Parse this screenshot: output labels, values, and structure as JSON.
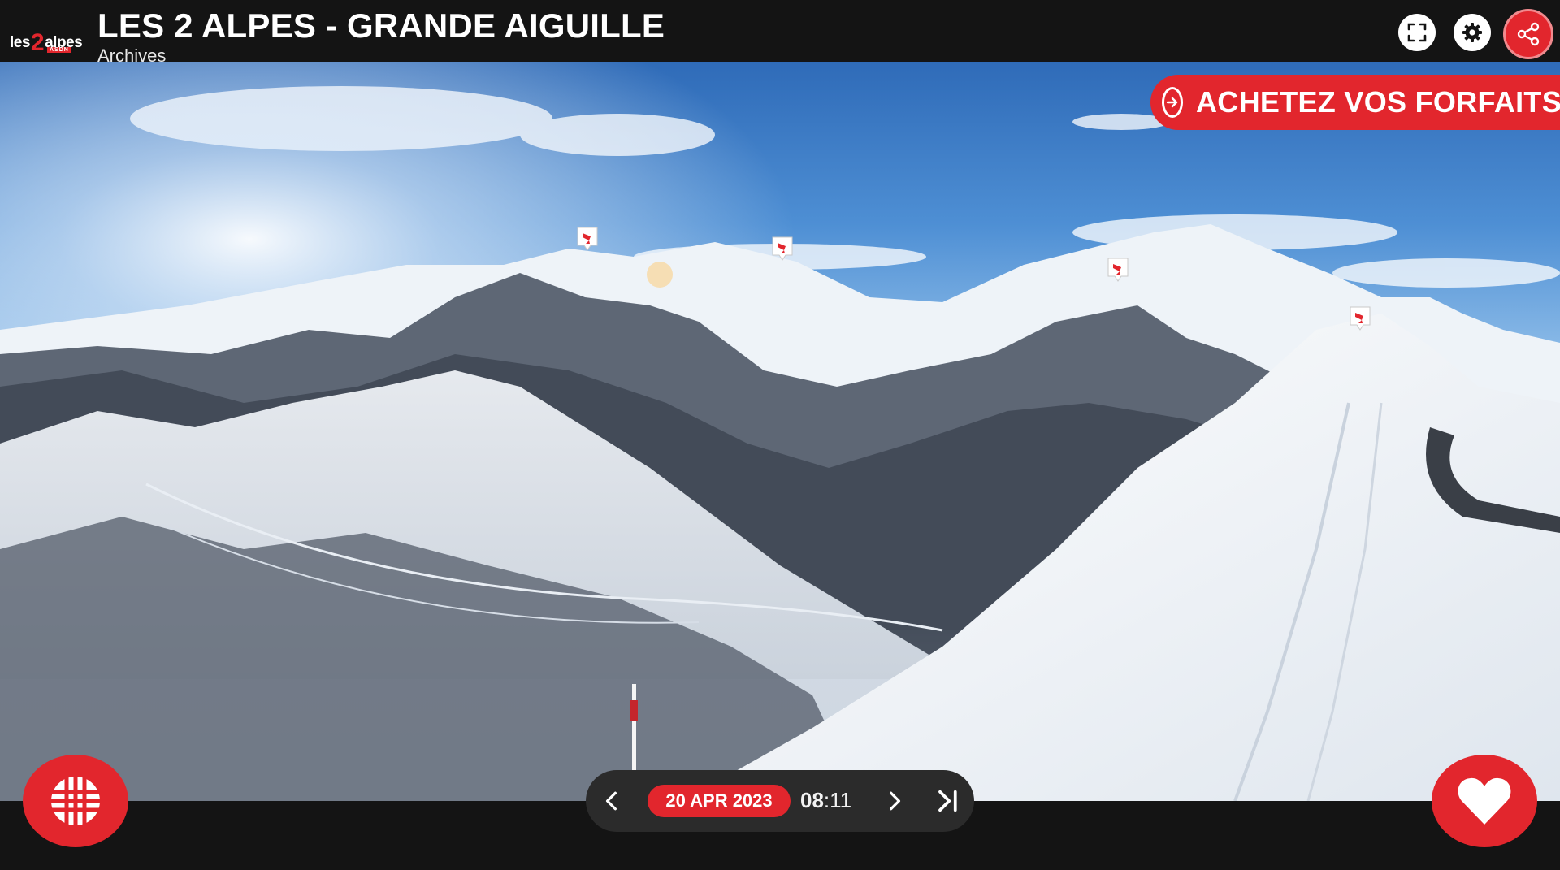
{
  "header": {
    "logo": {
      "prefix": "les",
      "number": "2",
      "suffix": "alpes",
      "tagline": "ASDN"
    },
    "title": "LES 2 ALPES - GRANDE AIGUILLE",
    "subtitle": "Archives",
    "buttons": [
      {
        "icon": "fullscreen-icon"
      },
      {
        "icon": "gear-icon"
      },
      {
        "icon": "share-icon"
      }
    ]
  },
  "cta": {
    "label": "ACHETEZ VOS FORFAITS",
    "icon": "arrow-right-circle-icon"
  },
  "webcam_pins": [
    {
      "icon": "webcam-icon"
    },
    {
      "icon": "webcam-icon"
    },
    {
      "icon": "webcam-icon"
    },
    {
      "icon": "webcam-icon"
    }
  ],
  "timeline": {
    "date": "20 APR 2023",
    "time_hours": "08",
    "time_minutes": ":11"
  },
  "colors": {
    "accent": "#e2262d",
    "header_bg": "#141414",
    "timebar_bg": "#2b2b2b"
  }
}
